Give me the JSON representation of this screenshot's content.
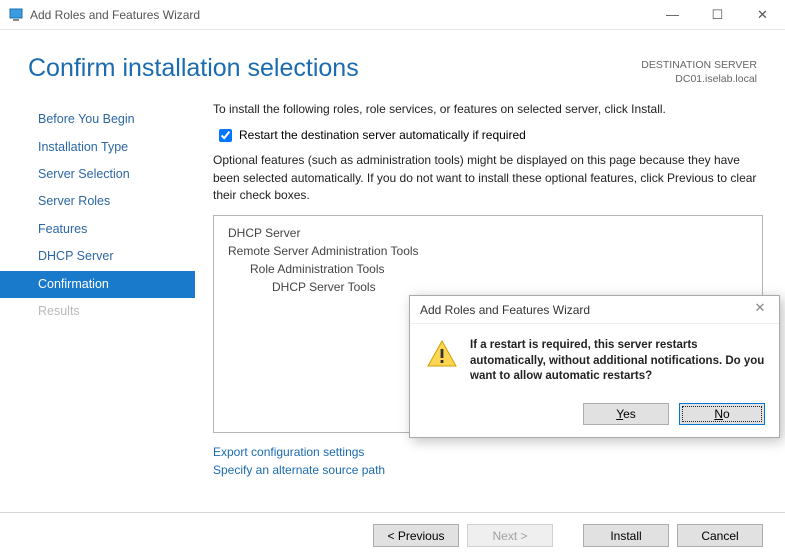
{
  "window": {
    "title": "Add Roles and Features Wizard"
  },
  "header": {
    "page_title": "Confirm installation selections",
    "dest_label": "DESTINATION SERVER",
    "dest_server": "DC01.iselab.local"
  },
  "steps": {
    "items": [
      {
        "label": "Before You Begin"
      },
      {
        "label": "Installation Type"
      },
      {
        "label": "Server Selection"
      },
      {
        "label": "Server Roles"
      },
      {
        "label": "Features"
      },
      {
        "label": "DHCP Server"
      },
      {
        "label": "Confirmation"
      },
      {
        "label": "Results"
      }
    ]
  },
  "main": {
    "intro": "To install the following roles, role services, or features on selected server, click Install.",
    "restart_label": "Restart the destination server automatically if required",
    "note": "Optional features (such as administration tools) might be displayed on this page because they have been selected automatically. If you do not want to install these optional features, click Previous to clear their check boxes.",
    "listbox": {
      "i0": "DHCP Server",
      "i1": "Remote Server Administration Tools",
      "i2": "Role Administration Tools",
      "i3": "DHCP Server Tools"
    },
    "link_export": "Export configuration settings",
    "link_source": "Specify an alternate source path"
  },
  "footer": {
    "previous": "< Previous",
    "next": "Next >",
    "install": "Install",
    "cancel": "Cancel"
  },
  "modal": {
    "title": "Add Roles and Features Wizard",
    "message": "If a restart is required, this server restarts automatically, without additional notifications. Do you want to allow automatic restarts?",
    "yes": "Yes",
    "no": "No"
  }
}
